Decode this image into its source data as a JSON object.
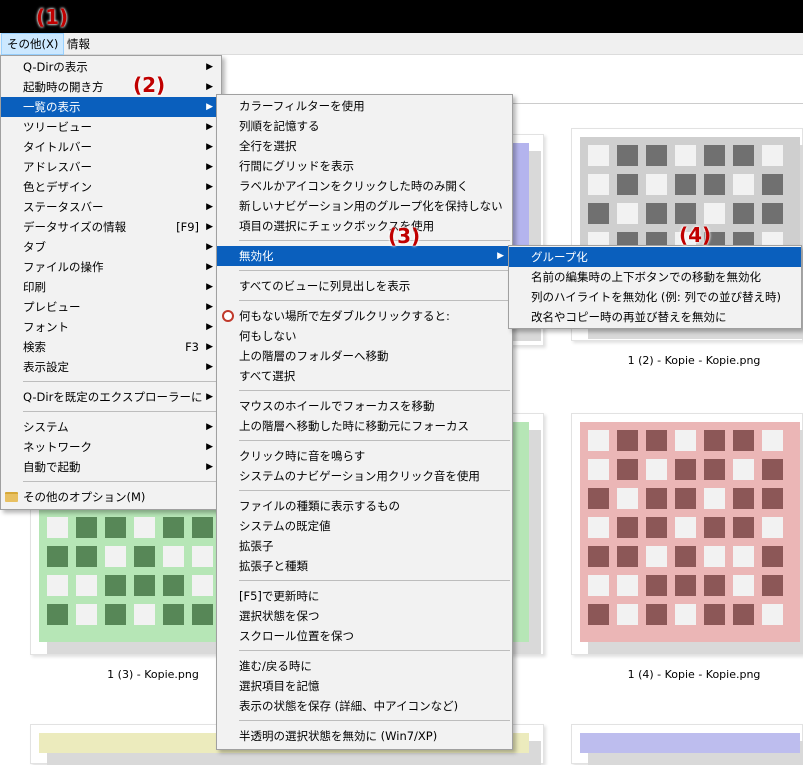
{
  "menubar": {
    "items": [
      "その他(X)",
      "情報"
    ]
  },
  "annotations": [
    "(1)",
    "(2)",
    "(3)",
    "(4)"
  ],
  "menu1": {
    "groups": [
      [
        {
          "label": "Q-Dirの表示",
          "submenu": true
        },
        {
          "label": "起動時の開き方",
          "submenu": true
        },
        {
          "label": "一覧の表示",
          "submenu": true,
          "highlighted": true
        },
        {
          "label": "ツリービュー",
          "submenu": true
        },
        {
          "label": "タイトルバー",
          "submenu": true
        },
        {
          "label": "アドレスバー",
          "submenu": true
        },
        {
          "label": "色とデザイン",
          "submenu": true
        },
        {
          "label": "ステータスバー",
          "submenu": true
        },
        {
          "label": "データサイズの情報",
          "shortcut": "[F9]",
          "submenu": true
        },
        {
          "label": "タブ",
          "submenu": true
        },
        {
          "label": "ファイルの操作",
          "submenu": true
        },
        {
          "label": "印刷",
          "submenu": true
        },
        {
          "label": "プレビュー",
          "submenu": true
        },
        {
          "label": "フォント",
          "submenu": true
        },
        {
          "label": "検索",
          "shortcut": "F3",
          "submenu": true
        },
        {
          "label": "表示設定",
          "submenu": true
        }
      ],
      [
        {
          "label": "Q-Dirを既定のエクスプローラーに",
          "submenu": true
        }
      ],
      [
        {
          "label": "システム",
          "submenu": true
        },
        {
          "label": "ネットワーク",
          "submenu": true
        },
        {
          "label": "自動で起動",
          "submenu": true
        }
      ],
      [
        {
          "label": "その他のオプション(M)",
          "icon": "folder-icon"
        }
      ]
    ]
  },
  "menu2": {
    "groups": [
      [
        {
          "label": "カラーフィルターを使用"
        },
        {
          "label": "列順を記憶する"
        },
        {
          "label": "全行を選択"
        },
        {
          "label": "行間にグリッドを表示"
        },
        {
          "label": "ラベルかアイコンをクリックした時のみ開く"
        },
        {
          "label": "新しいナビゲーション用のグループ化を保持しない"
        },
        {
          "label": "項目の選択にチェックボックスを使用"
        }
      ],
      [
        {
          "label": "無効化",
          "submenu": true,
          "highlighted": true
        }
      ],
      [
        {
          "label": "すべてのビューに列見出しを表示"
        }
      ],
      [
        {
          "label": "何もない場所で左ダブルクリックすると:",
          "icon": "radio-icon"
        },
        {
          "label": "何もしない"
        },
        {
          "label": "上の階層のフォルダーへ移動"
        },
        {
          "label": "すべて選択"
        }
      ],
      [
        {
          "label": "マウスのホイールでフォーカスを移動"
        },
        {
          "label": "上の階層へ移動した時に移動元にフォーカス"
        }
      ],
      [
        {
          "label": "クリック時に音を鳴らす"
        },
        {
          "label": "システムのナビゲーション用クリック音を使用"
        }
      ],
      [
        {
          "label": "ファイルの種類に表示するもの"
        },
        {
          "label": "システムの既定値"
        },
        {
          "label": "拡張子"
        },
        {
          "label": "拡張子と種類"
        }
      ],
      [
        {
          "label": "[F5]で更新時に"
        },
        {
          "label": "選択状態を保つ"
        },
        {
          "label": "スクロール位置を保つ"
        }
      ],
      [
        {
          "label": "進む/戻る時に"
        },
        {
          "label": "選択項目を記憶"
        },
        {
          "label": "表示の状態を保存 (詳細、中アイコンなど)"
        }
      ],
      [
        {
          "label": "半透明の選択状態を無効に (Win7/XP)"
        }
      ]
    ]
  },
  "menu3": {
    "groups": [
      [
        {
          "label": "グループ化",
          "highlighted": true
        },
        {
          "label": "名前の編集時の上下ボタンでの移動を無効化"
        },
        {
          "label": "列のハイライトを無効化 (例: 列での並び替え時)"
        },
        {
          "label": "改名やコピー時の再並び替えを無効に"
        }
      ]
    ]
  },
  "files": [
    {
      "caption": "",
      "color": "#b4b4ee"
    },
    {
      "caption": "1 (2) - Kopie - Kopie.png",
      "color": "#cfcfcf"
    },
    {
      "caption": "1 (3) - Kopie.png",
      "color": "#b6e6b6"
    },
    {
      "caption": "1 (4) - Kopie - Kopie.png",
      "color": "#ebb6b6"
    },
    {
      "caption": "",
      "color": "#ecebbd"
    },
    {
      "caption": "",
      "color": "#bdbdee"
    }
  ]
}
